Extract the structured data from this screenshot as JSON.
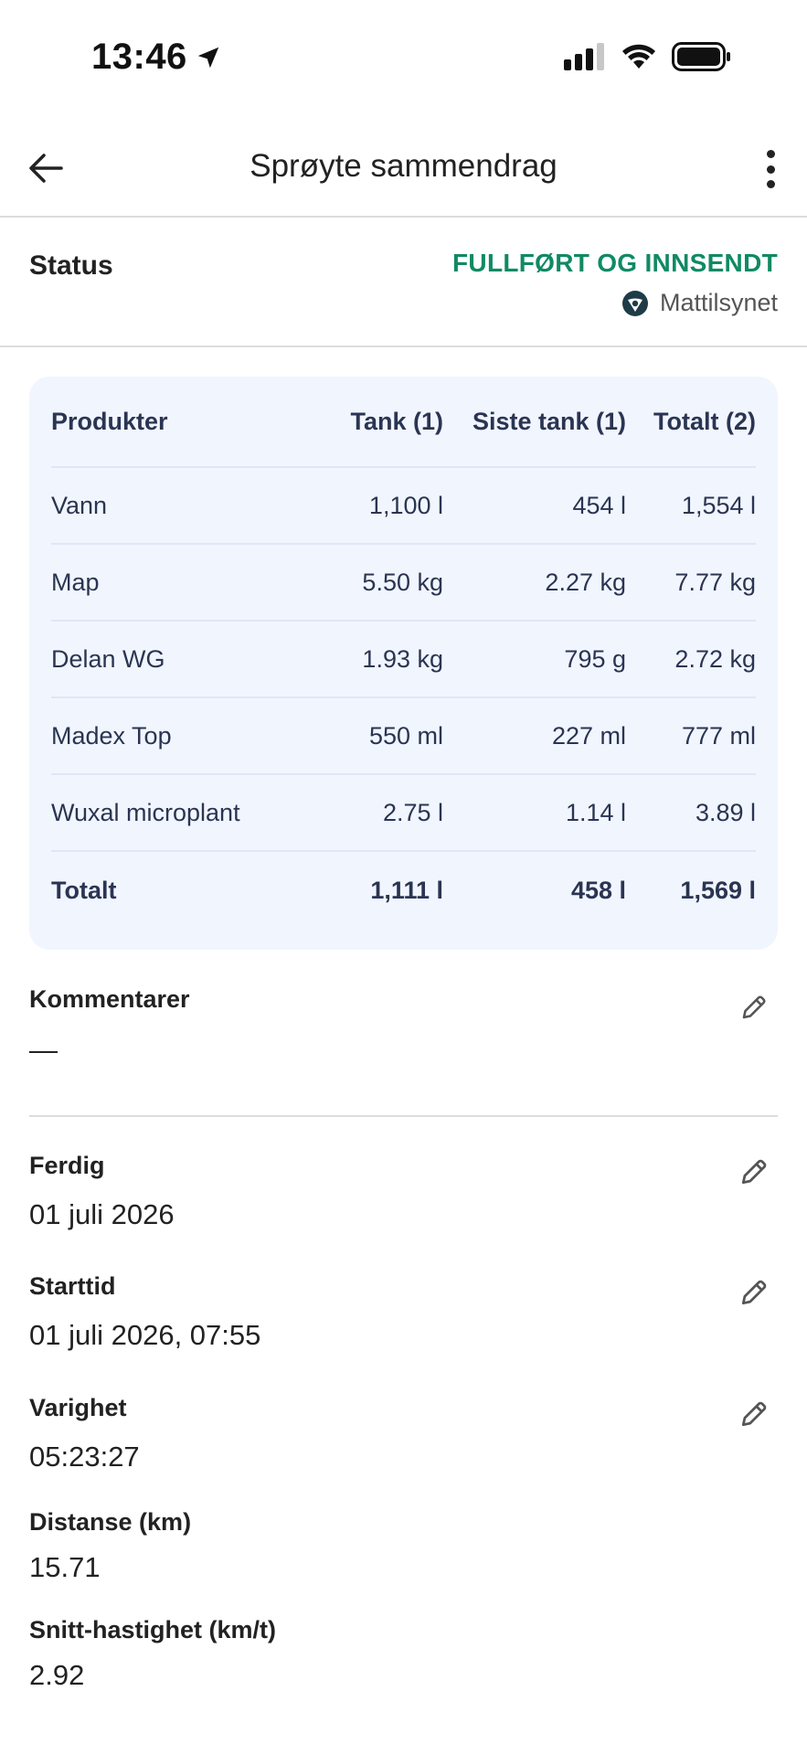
{
  "status_bar": {
    "time": "13:46",
    "icons": [
      "location-arrow-icon",
      "cellular-signal-icon",
      "wifi-icon",
      "battery-icon"
    ]
  },
  "header": {
    "title": "Sprøyte sammendrag",
    "back_icon": "arrow-left-icon",
    "more_icon": "more-vertical-icon"
  },
  "status": {
    "label": "Status",
    "value": "FULLFØRT OG INNSENDT",
    "authority": "Mattilsynet",
    "value_color": "#108a63"
  },
  "table": {
    "columns": [
      "Produkter",
      "Tank (1)",
      "Siste tank (1)",
      "Totalt (2)"
    ],
    "rows": [
      [
        "Vann",
        "1,100 l",
        "454 l",
        "1,554 l"
      ],
      [
        "Map",
        "5.50 kg",
        "2.27 kg",
        "7.77 kg"
      ],
      [
        "Delan WG",
        "1.93 kg",
        "795 g",
        "2.72 kg"
      ],
      [
        "Madex Top",
        "550 ml",
        "227 ml",
        "777 ml"
      ],
      [
        "Wuxal microplant",
        "2.75 l",
        "1.14 l",
        "3.89 l"
      ]
    ],
    "total": [
      "Totalt",
      "1,111 l",
      "458 l",
      "1,569 l"
    ],
    "background": "#f1f5fe"
  },
  "comments": {
    "label": "Kommentarer",
    "value": "—"
  },
  "details": {
    "finished": {
      "label": "Ferdig",
      "value": "01 juli 2026"
    },
    "start_time": {
      "label": "Starttid",
      "value": "01 juli 2026, 07:55"
    },
    "duration": {
      "label": "Varighet",
      "value": "05:23:27"
    },
    "distance": {
      "label": "Distanse (km)",
      "value": "15.71"
    },
    "avg_speed": {
      "label": "Snitt-hastighet (km/t)",
      "value": "2.92"
    }
  }
}
